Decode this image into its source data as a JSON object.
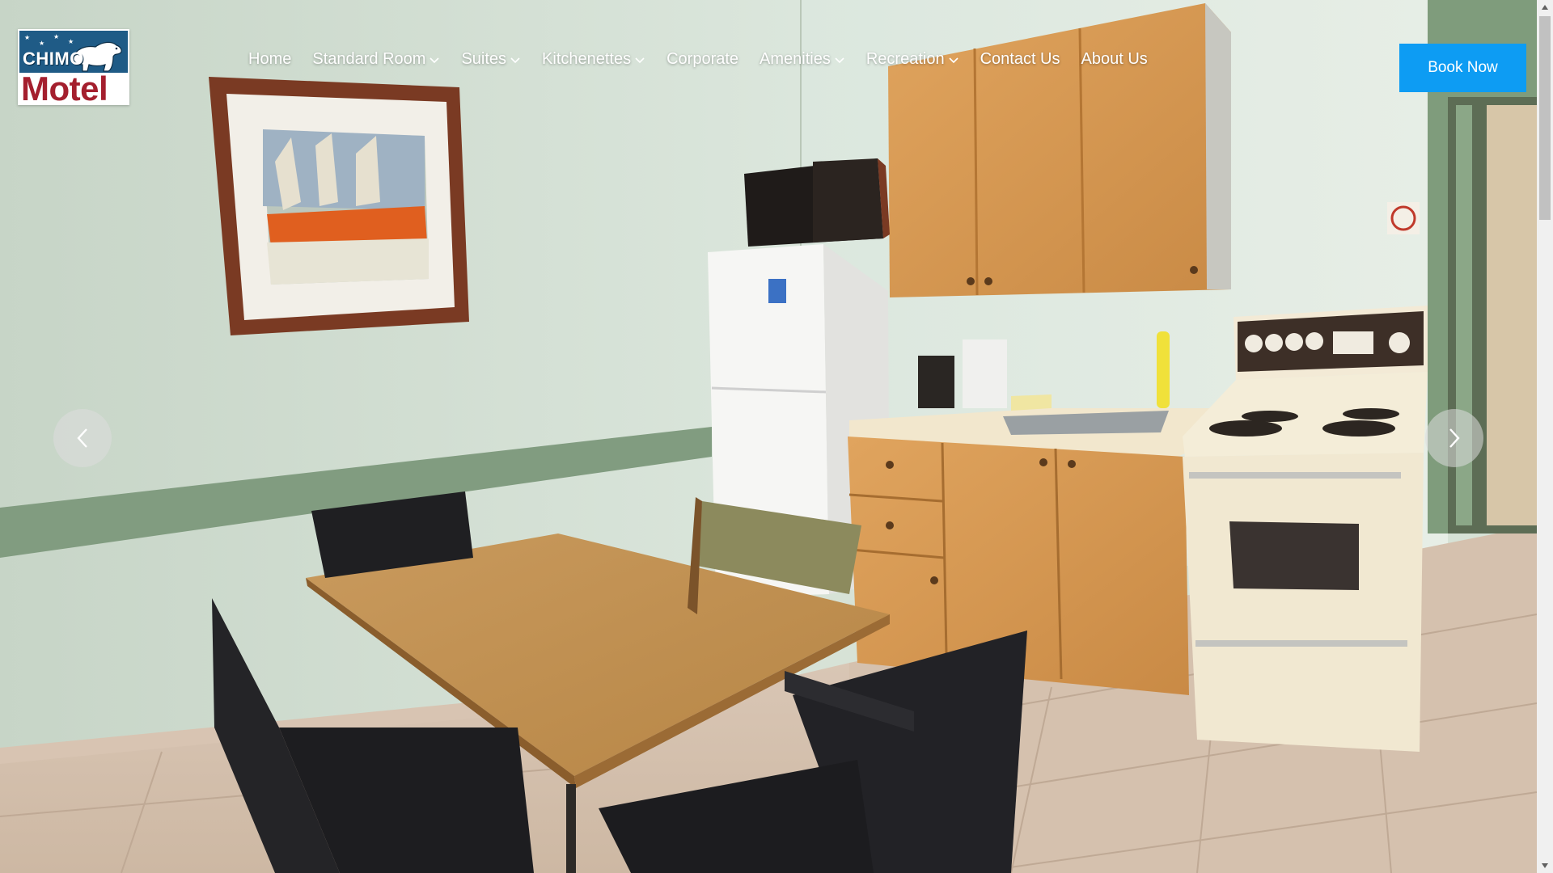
{
  "logo": {
    "line1": "CHIMO",
    "line2": "Motel",
    "bear_icon": "polar-bear-icon",
    "colors": {
      "top": "#1f5b86",
      "wordmark": "#a41f2e"
    }
  },
  "nav": {
    "items": [
      {
        "label": "Home",
        "dropdown": false
      },
      {
        "label": "Standard Room",
        "dropdown": true
      },
      {
        "label": "Suites",
        "dropdown": true
      },
      {
        "label": "Kitchenettes",
        "dropdown": true
      },
      {
        "label": "Corporate",
        "dropdown": false
      },
      {
        "label": "Amenities",
        "dropdown": true
      },
      {
        "label": "Recreation",
        "dropdown": true
      },
      {
        "label": "Contact Us",
        "dropdown": false
      },
      {
        "label": "About Us",
        "dropdown": false
      }
    ]
  },
  "cta": {
    "book_label": "Book Now",
    "color": "#0d9cf3"
  },
  "slider": {
    "prev_icon": "chevron-left-icon",
    "next_icon": "chevron-right-icon"
  },
  "scrollbar": {
    "up_icon": "scroll-up-arrow-icon",
    "down_icon": "scroll-down-arrow-icon"
  }
}
